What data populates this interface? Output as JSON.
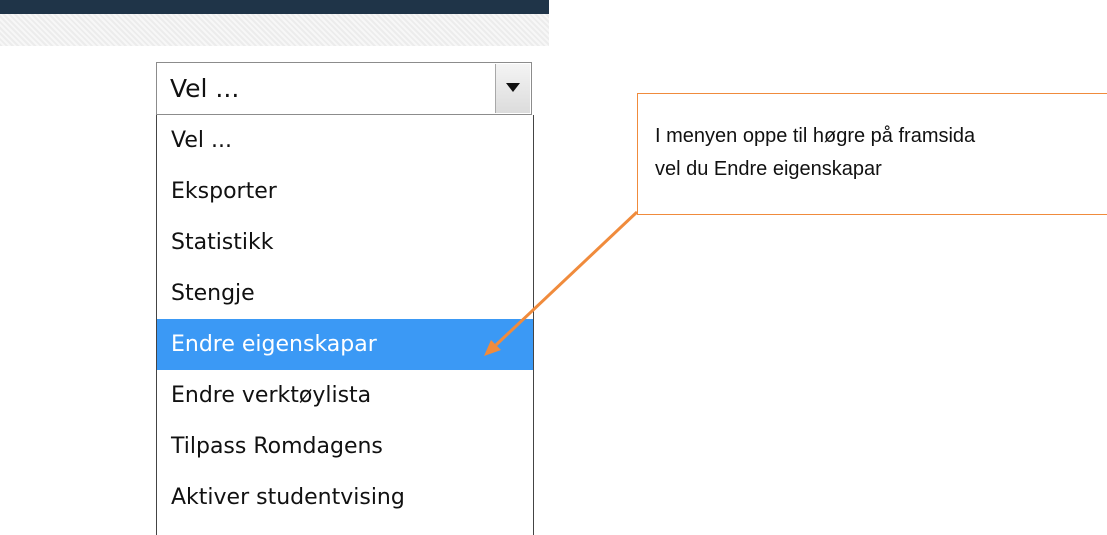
{
  "select": {
    "value": "Vel ...",
    "arrow_icon": "chevron-down-icon"
  },
  "dropdown": {
    "items": [
      {
        "label": "Vel ...",
        "selected": false
      },
      {
        "label": "Eksporter",
        "selected": false
      },
      {
        "label": "Statistikk",
        "selected": false
      },
      {
        "label": "Stengje",
        "selected": false
      },
      {
        "label": "Endre eigenskapar",
        "selected": true
      },
      {
        "label": "Endre verktøylista",
        "selected": false
      },
      {
        "label": "Tilpass Romdagens",
        "selected": false
      },
      {
        "label": "Aktiver studentvising",
        "selected": false
      }
    ],
    "selected_color": "#3b99f5"
  },
  "callout": {
    "line1": "I menyen oppe til høgre på framsida",
    "line2": "vel du Endre eigenskapar",
    "border_color": "#f08b3c",
    "arrow_color": "#f08b3c"
  },
  "colors": {
    "top_bar": "#1f3448"
  }
}
